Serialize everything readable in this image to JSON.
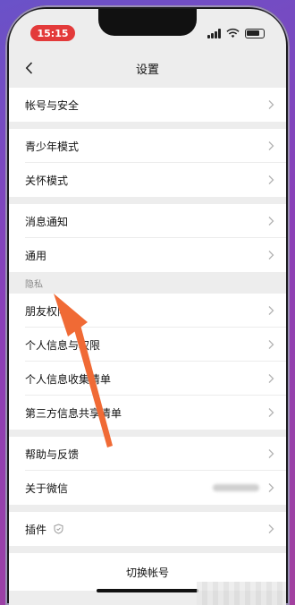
{
  "status_bar": {
    "time": "15:15"
  },
  "nav": {
    "title": "设置"
  },
  "groups": [
    {
      "items": [
        {
          "label": "帐号与安全"
        }
      ]
    },
    {
      "items": [
        {
          "label": "青少年模式"
        },
        {
          "label": "关怀模式"
        }
      ]
    },
    {
      "items": [
        {
          "label": "消息通知"
        },
        {
          "label": "通用"
        }
      ]
    }
  ],
  "privacy": {
    "section_label": "隐私",
    "items": [
      {
        "label": "朋友权限"
      },
      {
        "label": "个人信息与权限"
      },
      {
        "label": "个人信息收集清单"
      },
      {
        "label": "第三方信息共享清单"
      }
    ]
  },
  "help_group": [
    {
      "label": "帮助与反馈"
    },
    {
      "label": "关于微信"
    }
  ],
  "plugins": {
    "label": "插件"
  },
  "switch_account": {
    "label": "切换帐号"
  },
  "annotation": {
    "color": "#f06a35"
  }
}
